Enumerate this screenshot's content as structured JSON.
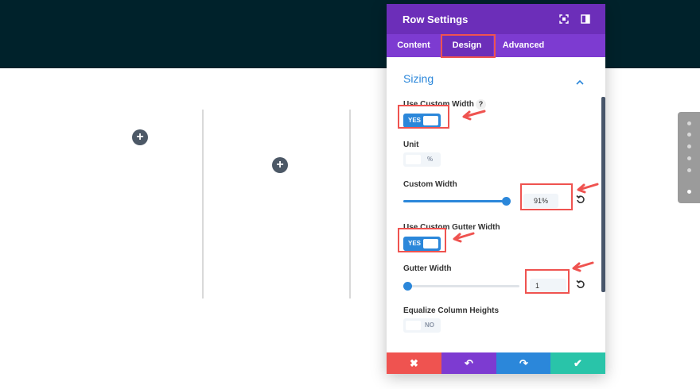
{
  "modal": {
    "title": "Row Settings",
    "tabs": [
      {
        "label": "Content",
        "active": false
      },
      {
        "label": "Design",
        "active": true
      },
      {
        "label": "Advanced",
        "active": false
      }
    ],
    "section": {
      "title": "Sizing",
      "expanded": true
    },
    "fields": {
      "use_custom_width": {
        "label": "Use Custom Width",
        "help": "?",
        "value": "YES"
      },
      "unit": {
        "label": "Unit",
        "value": "%"
      },
      "custom_width": {
        "label": "Custom Width",
        "value": "91%",
        "slider_fraction": 0.91
      },
      "use_custom_gutter_width": {
        "label": "Use Custom Gutter Width",
        "value": "YES"
      },
      "gutter_width": {
        "label": "Gutter Width",
        "value": "1",
        "slider_fraction": 0.0
      },
      "equalize_column_heights": {
        "label": "Equalize Column Heights",
        "value": "NO"
      }
    },
    "footer": {
      "cancel_icon": "✖",
      "undo_icon": "↶",
      "redo_icon": "↷",
      "save_icon": "✔"
    }
  },
  "canvas": {
    "add_icon": "+",
    "page_dots": {
      "count": 6,
      "active_index": 5
    }
  },
  "colors": {
    "topbar": "#00222b",
    "modal_header": "#6c2eb9",
    "tab_bar": "#7d3bd1",
    "accent_blue": "#2b87da",
    "highlight_red": "#ef5350",
    "cancel": "#ef5350",
    "undo": "#7d3bd1",
    "redo": "#2b87da",
    "save": "#29c4a9"
  },
  "icons": [
    "expand-icon",
    "sidebar-toggle-icon",
    "chevron-up-icon",
    "help-icon",
    "reset-icon",
    "close-icon",
    "undo-icon",
    "redo-icon",
    "check-icon",
    "add-icon"
  ]
}
